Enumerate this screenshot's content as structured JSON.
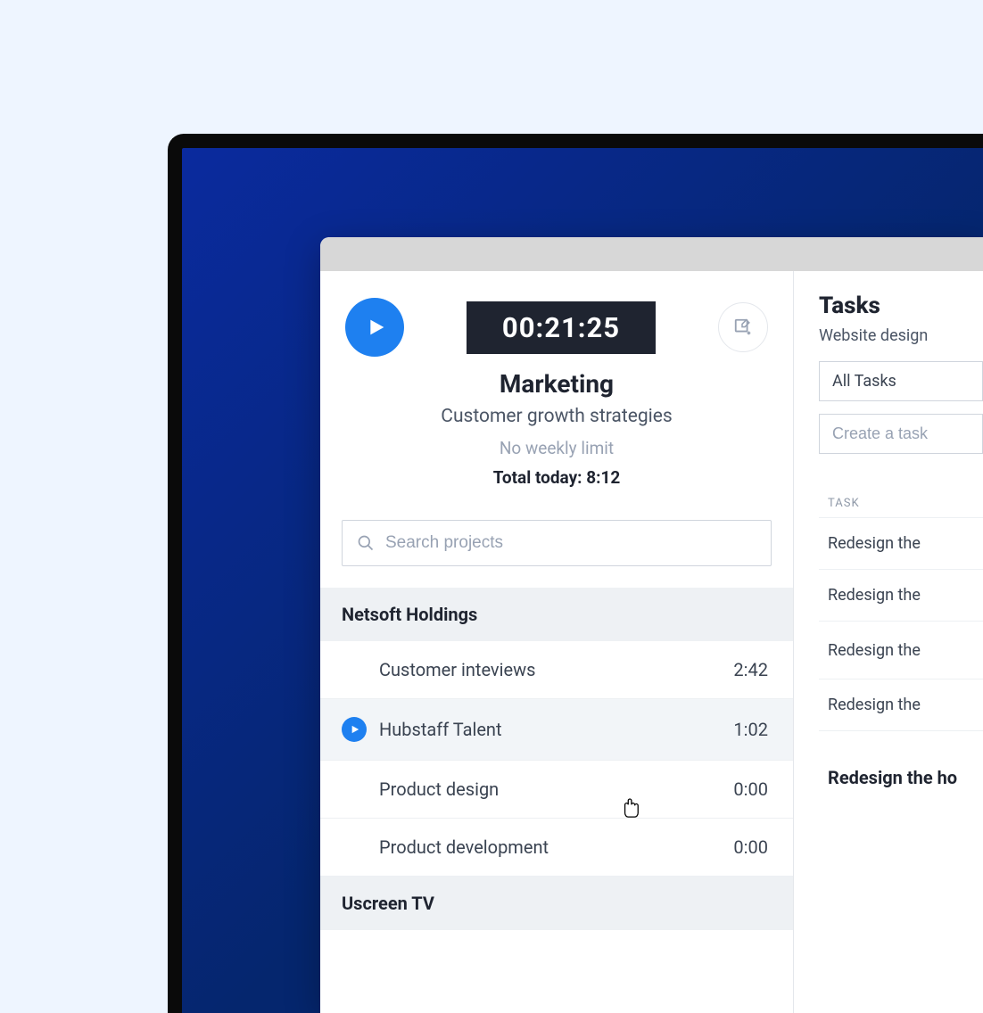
{
  "timer": {
    "current": "00:21:25",
    "project_name": "Marketing",
    "project_sub": "Customer growth strategies",
    "limit": "No weekly limit",
    "total_today": "Total today: 8:12"
  },
  "search": {
    "placeholder": "Search projects"
  },
  "companies": [
    {
      "name": "Netsoft Holdings",
      "projects": [
        {
          "name": "Customer inteviews",
          "time": "2:42",
          "active": false
        },
        {
          "name": "Hubstaff Talent",
          "time": "1:02",
          "active": true
        },
        {
          "name": "Product design",
          "time": "0:00",
          "active": false
        },
        {
          "name": "Product development",
          "time": "0:00",
          "active": false
        }
      ]
    },
    {
      "name": "Uscreen TV",
      "projects": []
    }
  ],
  "tasks": {
    "title": "Tasks",
    "subtitle": "Website design",
    "filter_selected": "All Tasks",
    "create_placeholder": "Create a task",
    "col_header": "TASK",
    "items": [
      {
        "name": "Redesign the",
        "active": false
      },
      {
        "name": "Redesign the",
        "active": false
      },
      {
        "name": "Redesign the",
        "active": true
      },
      {
        "name": "Redesign the",
        "active": false
      }
    ],
    "bottom": "Redesign the ho"
  }
}
